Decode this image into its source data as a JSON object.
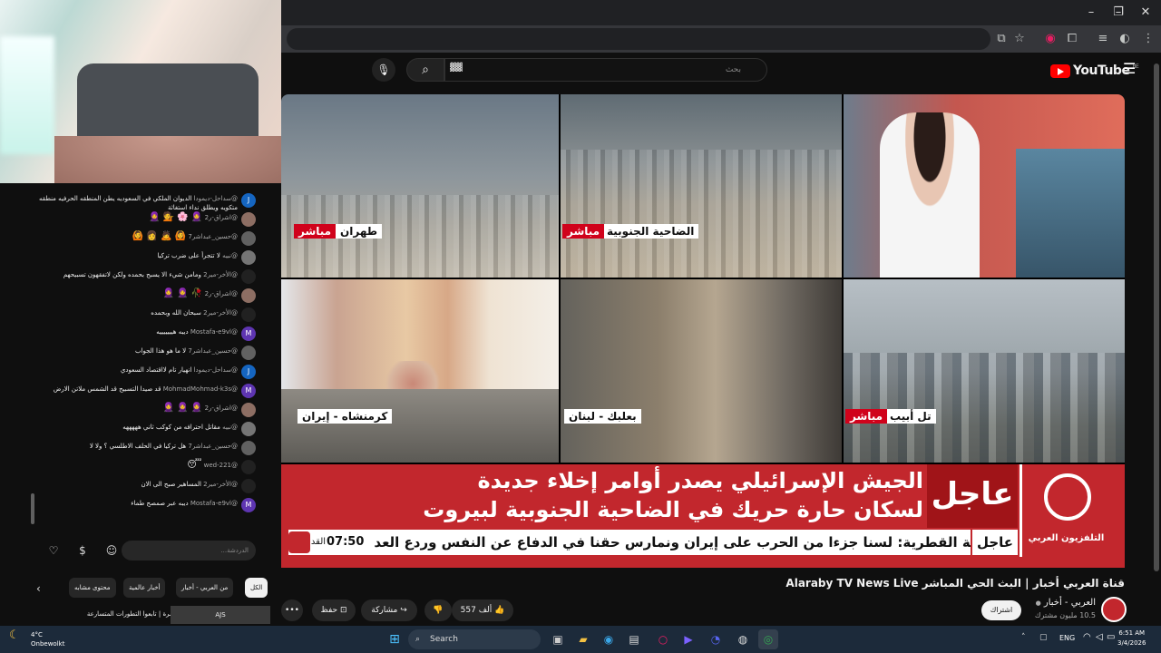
{
  "browser": {
    "window_controls": {
      "minimize": "–",
      "maximize": "❐",
      "close": "✕"
    }
  },
  "youtube": {
    "logo_text": "YouTube",
    "logo_region": "BE",
    "search_placeholder": "بحث",
    "search_typed": "▓▓",
    "video": {
      "tiles": [
        {
          "city": "طهران",
          "live": "مباشر"
        },
        {
          "city": "الضاحية الجنوبية",
          "live": "مباشر"
        },
        {
          "city": "كرمنشاه - إيران"
        },
        {
          "city": "بعلبك - لبنان"
        },
        {
          "city": "تل أبيب",
          "live": "مباشر"
        }
      ],
      "urgent_label": "عاجل",
      "headline_line1": "الجيش الإسرائيلي يصدر أوامر إخلاء جديدة",
      "headline_line2": "لسكان حارة حريك في الضاحية الجنوبية لبيروت",
      "ticker_tag": "عاجل",
      "ticker_text": "خارجية القطرية: لسنا جزءا من الحرب على إيران ونمارس حقنا في الدفاع عن النفس وردع العد",
      "clock": "07:50",
      "clock_suffix": "القد",
      "channel_logo_text": "التلفزيون العربي"
    },
    "title": "قناة العربي أخبار | البث الحي المباشر Alaraby TV News Live",
    "channel": {
      "name": "العربي - أخبار",
      "verified": "●",
      "subscribers": "10.5 مليون مشترك",
      "subscribe": "اشتراك"
    },
    "actions": {
      "likes": "557 ألف",
      "share": "مشاركة",
      "save": "حفظ",
      "more": "•••"
    }
  },
  "chat": {
    "messages": [
      {
        "who": "@سداحل-ديمودا",
        "text": "الديوان الملكي في السعوديه يطن المنطقه الحرفيه منطقه متكويه ويطلق نداء استغاثة",
        "av": "J",
        "color": "#1565c0"
      },
      {
        "who": "@اشراق-ر2",
        "emoji": "🧕 🌸 💁 🧕",
        "av": "",
        "color": "#8d6e63"
      },
      {
        "who": "@حسين_عبداشر7",
        "emoji": "🙆 🙇 👩 🙆",
        "av": "",
        "color": "#616161"
      },
      {
        "who": "@نبيه",
        "text": "لا تتجرأ على ضرب تركيا",
        "av": "",
        "color": "#757575"
      },
      {
        "who": "@الأخر-مير2",
        "text": "ومامن شيء الا يسبح بحمده ولكن لاتفقهون تسبيحهم",
        "av": "",
        "color": "#212121"
      },
      {
        "who": "@اشراق-ر2",
        "emoji": "🥀 🧕 🧕",
        "av": "",
        "color": "#8d6e63"
      },
      {
        "who": "@الأخر-مير2",
        "text": "سبحان الله وبحمده",
        "av": "",
        "color": "#212121"
      },
      {
        "who": "@Mostafa-e9vl",
        "text": "ديبه هيييييييه",
        "av": "M",
        "color": "#5e35b1"
      },
      {
        "who": "@حسين_عبداشر7",
        "text": "لا ما هو هذا الجواب",
        "av": "",
        "color": "#616161"
      },
      {
        "who": "@سداحل-ديمودا",
        "text": "انهيار تام لااقتصاد السعودي",
        "av": "J",
        "color": "#1565c0"
      },
      {
        "who": "@MohmadMohmad-k3s",
        "text": "قد صيدا التسبيح قد الشمس ملاتن الارض",
        "av": "M",
        "color": "#5e35b1"
      },
      {
        "who": "@اشراق-ر2",
        "emoji": "🧕 🧕 🧕",
        "av": "",
        "color": "#8d6e63"
      },
      {
        "who": "@نبيه",
        "text": "مقاتل احترافه من كوكب ثاني هههههه",
        "av": "",
        "color": "#757575"
      },
      {
        "who": "@حسين_عبداشر7",
        "text": "هل تركيا في الحلف الاطلسي ؟ ولا لا",
        "av": "",
        "color": "#616161"
      },
      {
        "who": "@wed-221",
        "emoji": "😴",
        "av": "",
        "color": "#212121"
      },
      {
        "who": "@الأخر-مير2",
        "text": "المساهير صبح الى الان",
        "av": "",
        "color": "#212121"
      },
      {
        "who": "@Mostafa-e9vl",
        "text": "ديبه عبر صمصح طماء",
        "av": "M",
        "color": "#5e35b1"
      }
    ],
    "input_placeholder": "الدردشة...",
    "chips": [
      "الكل",
      "من العربي - أخبار",
      "أخبار عالمية",
      "محتوى مشابه"
    ],
    "rec_title": "تغطية مباشرة | تابعوا التطورات المتسارعة",
    "rec_thumb": "AJS"
  },
  "taskbar": {
    "weather_temp": "4°C",
    "weather_desc": "Onbewolkt",
    "search": "Search",
    "lang": "ENG",
    "time": "6:51 AM",
    "date": "3/4/2026"
  }
}
